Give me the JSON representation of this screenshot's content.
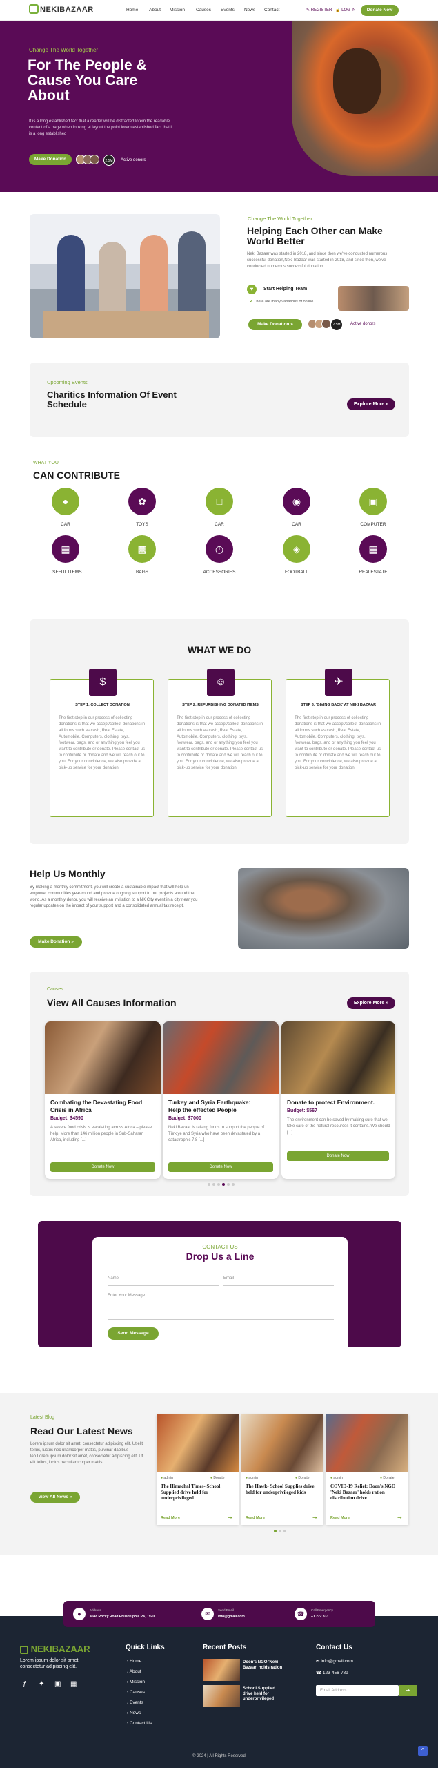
{
  "header": {
    "logo": "NEKIBAZAAR",
    "nav": [
      "Home",
      "About",
      "Mission",
      "Causes",
      "Events",
      "News",
      "Contact"
    ],
    "register": "REGISTER",
    "login": "LOG IN",
    "donate_btn": "Donate Now"
  },
  "hero": {
    "eyebrow": "Change The World Together",
    "title_l1": "For The People &",
    "title_l2": "Cause You Care",
    "title_l3": "About",
    "body": "It is a long established fact that a reader will be distracted lorem the readable content of a page when looking at layout the point lorem established fact that it is a long established",
    "cta": "Make Donation",
    "avatar_badge": "2.5M",
    "donors": "Active donors"
  },
  "about": {
    "eyebrow": "Change The World Together",
    "title_l1": "Helping Each Other can Make",
    "title_l2": "World Better",
    "body": "Neki Bazaar was started in 2018, and since then we've conducted numerous successful donation,Neki Bazaar was started in 2018, and since then, we've conducted numerous successful donation",
    "team": "Start Helping Team",
    "check": "There are many variations of online",
    "cta": "Make Donation",
    "avatar_badge": "2.5M",
    "donors": "Active donors"
  },
  "events": {
    "eyebrow": "Upcoming Events",
    "title_l1": "Charitics Information Of Event",
    "title_l2": "Schedule",
    "btn": "Explore More"
  },
  "contribute": {
    "eyebrow": "WHAT YOU",
    "title": "CAN CONTRIBUTE",
    "items": [
      "CAR",
      "TOYS",
      "CAR",
      "CAR",
      "COMPUTER",
      "USEFUL ITEMS",
      "BAGS",
      "ACCESSORIES",
      "FOOTBALL",
      "REALESTATE"
    ]
  },
  "whatwedo": {
    "title": "WHAT WE DO",
    "steps": [
      {
        "title": "STEP 1: COLLECT DONATION",
        "body": "The first step in our process of collecting donations is that we accept/collect donations in all forms such as cash, Real Estate, Automobile, Computers, clothing, toys, footwear, bags, and or anything you feel you want to contribute or donate. Please contact us to contribute or donate and we will reach out to you. For your convinience, we also provide a pick-up service for your donation."
      },
      {
        "title": "STEP 2: REFURBISHING DONATED ITEMS",
        "body": "The first step in our process of collecting donations is that we accept/collect donations in all forms such as cash, Real Estate, Automobile, Computers, clothing, toys, footwear, bags, and or anything you feel you want to contribute or donate. Please contact us to contribute or donate and we will reach out to you. For your convinience, we also provide a pick-up service for your donation."
      },
      {
        "title": "STEP 3: 'GIVING BACK' AT NEKI BAZAAR",
        "body": "The first step in our process of collecting donations is that we accept/collect donations in all forms such as cash, Real Estate, Automobile, Computers, clothing, toys, footwear, bags, and or anything you feel you want to contribute or donate. Please contact us to contribute or donate and we will reach out to you. For your convinience, we also provide a pick-up service for your donation."
      }
    ]
  },
  "monthly": {
    "title": "Help Us Monthly",
    "body": "By making a monthly commitment, you will create a sustainable impact that will help un-empower communities year-round and provide ongoing support to our projects around the world. As a monthly donor, you will receive an invitation to a NK City event in a city near you regular updates on the impact of your support and a consolidated annual tax receipt.",
    "cta": "Make Donation"
  },
  "causes": {
    "eyebrow": "Causes",
    "title": "View All Causes Information",
    "btn": "Explore More",
    "cards": [
      {
        "title_l1": "Combating the Devastating Food",
        "title_l2": "Crisis in Africa",
        "budget": "Budget: $4590",
        "body": "A severe food crisis is escalating across Africa – please help. More than 146 million people in Sub-Saharan Africa, including [...]",
        "btn": "Donate Now"
      },
      {
        "title_l1": "Turkey and Syria Earthquake:",
        "title_l2": "Help the effected People",
        "budget": "Budget: $7000",
        "body": "Neki Bazaar is raising funds to support the people of Türkiye and Syria who have been devastated by a catastrophic 7.8 [...]",
        "btn": "Donate Now"
      },
      {
        "title_l1": "Donate to protect Environment.",
        "title_l2": "",
        "budget": "Budget: $567",
        "body": "The environment can be saved by making sure that we take care of the natural resources it contains. We should [...]",
        "btn": "Donate Now"
      }
    ]
  },
  "contact": {
    "eyebrow": "CONTACT US",
    "title": "Drop Us a Line",
    "name": "Name",
    "email": "Email",
    "message": "Enter Your Message",
    "btn": "Send Message"
  },
  "news": {
    "eyebrow": "Latest Blog",
    "title": "Read Our Latest News",
    "body": "Lorem ipsum dolor sit amet, consectetur adipiscing elit. Ut elit tellus, luctus nec ullamcorper mattis, pulvinar dapibus leo.Lorem ipsum dolor sit amet, consectetur adipiscing elit. Ut elit tellus, luctus nec ullamcorper mattis",
    "cta": "View All News",
    "cards": [
      {
        "author": "admin",
        "cat": "Donate",
        "title": "The Himachal Times- School Supplied drive held for underprivileged",
        "more": "Read More"
      },
      {
        "author": "admin",
        "cat": "Donate",
        "title": "The Hawk- School Supplies drive held for underprivileged kids",
        "more": "Read More"
      },
      {
        "author": "admin",
        "cat": "Donate",
        "title": "COVID-19 Relief: Doon's NGO 'Neki Bazaar' holds ration distribution drive",
        "more": "Read More"
      }
    ]
  },
  "infobar": {
    "address_label": "Address",
    "address": "4048 Rocky Road Philadelphia PA, 1920",
    "email_label": "Send Email",
    "email": "info@gmail.com",
    "phone_label": "Call Emergency",
    "phone": "+1 222 333"
  },
  "footer": {
    "logo": "NEKIBAZAAR",
    "tagline": "Lorem ipsum dolor sit amet, consectetur adipiscing elit.",
    "quick_title": "Quick Links",
    "quick": [
      "Home",
      "About",
      "Mission",
      "Causes",
      "Events",
      "News",
      "Contact Us"
    ],
    "recent_title": "Recent Posts",
    "recent": [
      "Doon's NGO 'Neki Bazaar' holds ration",
      "School Supplied drive held for underprivileged"
    ],
    "contact_title": "Contact Us",
    "email": "info@gmail.com",
    "phone": "123-456-789",
    "email_placeholder": "Email Address",
    "copyright": "© 2024 | All Rights Reserved"
  }
}
